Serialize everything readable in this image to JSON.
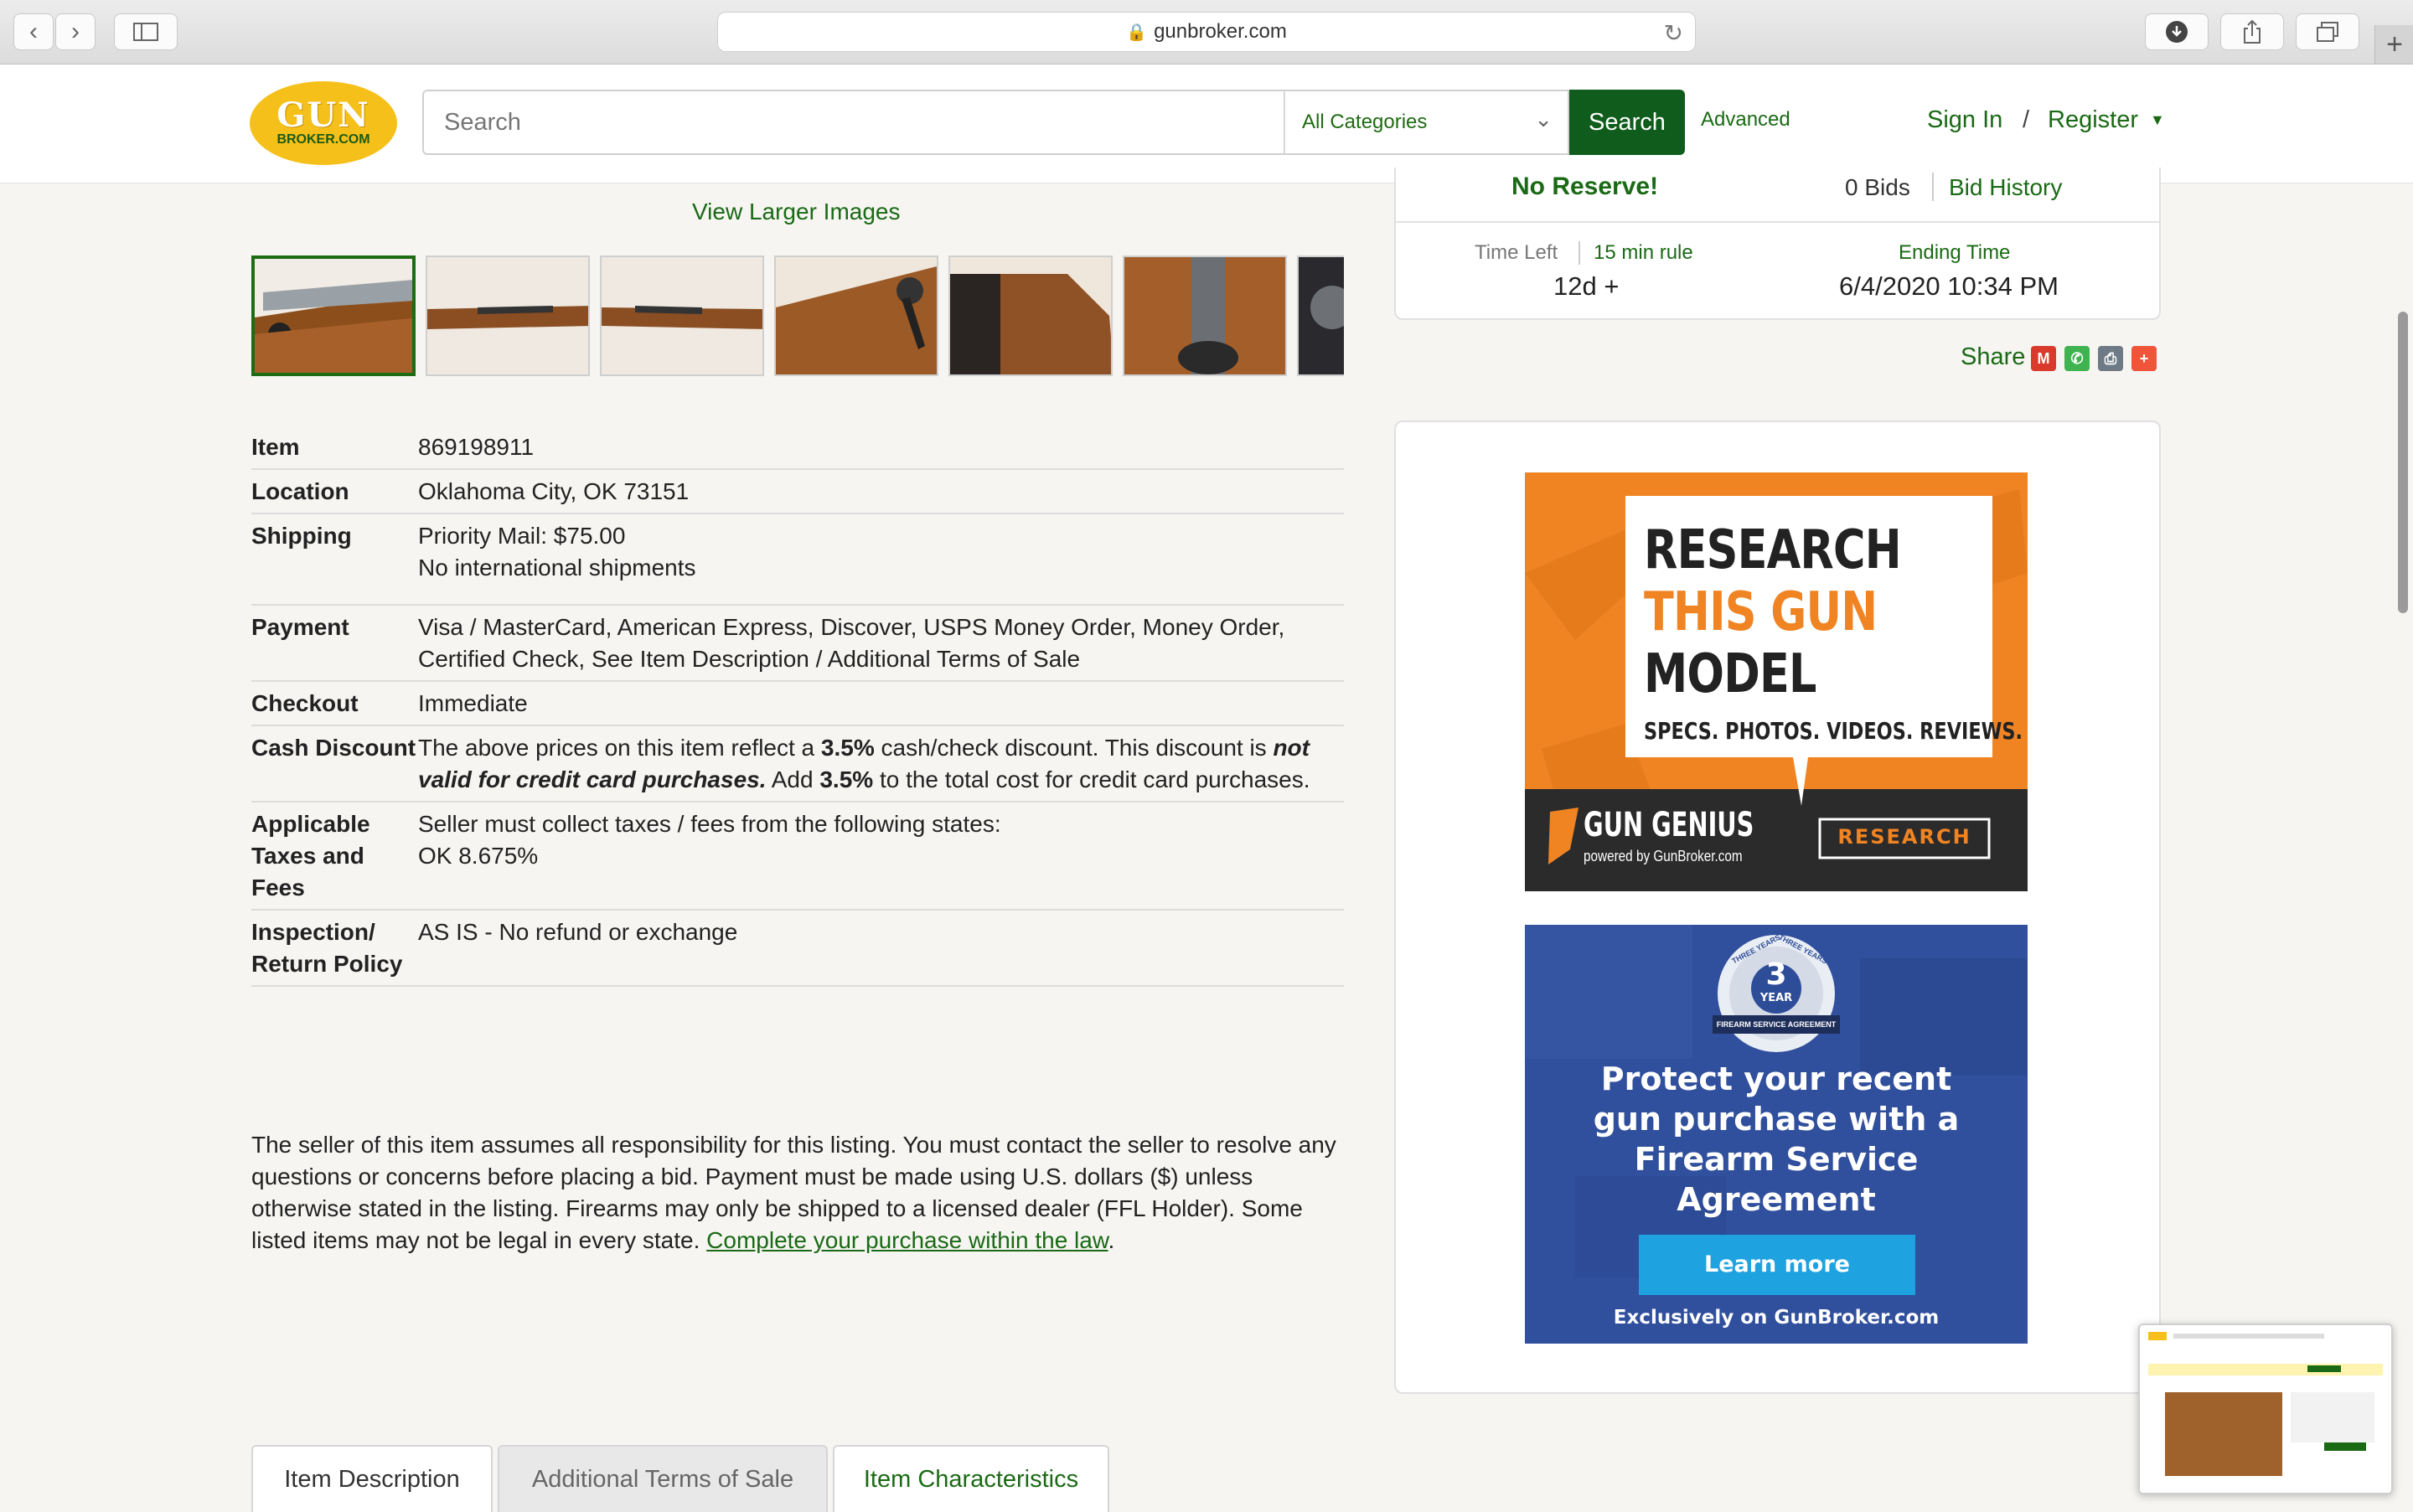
{
  "browser": {
    "url": "gunbroker.com",
    "reload_icon": "reload-icon",
    "lock_icon": "lock-icon"
  },
  "header": {
    "logo_line1": "GUN",
    "logo_line2": "BROKER.COM",
    "search_placeholder": "Search",
    "category": "All Categories",
    "search_button": "Search",
    "advanced": "Advanced",
    "sign_in": "Sign In",
    "separator": "/",
    "register": "Register"
  },
  "bid_panel": {
    "no_reserve": "No Reserve!",
    "bids": "0 Bids",
    "bid_history": "Bid History",
    "time_left_label": "Time Left",
    "rule_link": "15 min rule",
    "time_left": "12d +",
    "ending_label": "Ending Time",
    "ending_time": "6/4/2020 10:34 PM"
  },
  "share": {
    "label": "Share",
    "icons": [
      "gmail-icon",
      "whatsapp-icon",
      "print-icon",
      "more-share-icon"
    ]
  },
  "gallery": {
    "view_larger": "View Larger Images"
  },
  "details": {
    "item_label": "Item",
    "item": "869198911",
    "location_label": "Location",
    "location": "Oklahoma City, OK 73151",
    "shipping_label": "Shipping",
    "shipping_line1": "Priority Mail: $75.00",
    "shipping_line2": "No international shipments",
    "payment_label": "Payment",
    "payment": "Visa / MasterCard, American Express, Discover, USPS Money Order, Money Order, Certified Check, See Item Description / Additional Terms of Sale",
    "checkout_label": "Checkout",
    "checkout": "Immediate",
    "cash_label": "Cash Discount",
    "cash_t1": "The above prices on this item reflect a ",
    "cash_pct1": "3.5%",
    "cash_t2": " cash/check discount. This discount is ",
    "cash_em": "not valid for credit card purchases.",
    "cash_t3": " Add ",
    "cash_pct2": "3.5%",
    "cash_t4": " to the total cost for credit card purchases.",
    "taxes_label": "Applicable Taxes and Fees",
    "taxes_line1": "Seller must collect taxes / fees from the following states:",
    "taxes_line2": "OK 8.675%",
    "inspection_label": "Inspection/ Return Policy",
    "inspection": "AS IS - No refund or exchange"
  },
  "disclaimer": {
    "text": "The seller of this item assumes all responsibility for this listing. You must contact the seller to resolve any questions or concerns before placing a bid. Payment must be made using U.S. dollars ($) unless otherwise stated in the listing. Firearms may only be shipped to a licensed dealer (FFL Holder). Some listed items may not be legal in every state. ",
    "link": "Complete your purchase within the law",
    "end": "."
  },
  "tabs": [
    "Item Description",
    "Additional Terms of Sale",
    "Item Characteristics"
  ],
  "ad_research": {
    "line1": "RESEARCH",
    "line2": "THIS GUN",
    "line3": "MODEL",
    "tagline": "SPECS. PHOTOS. VIDEOS. REVIEWS.",
    "brand": "GUN GENIUS",
    "brand_sub": "powered by GunBroker.com",
    "button": "RESEARCH"
  },
  "ad_protect": {
    "badge_number": "3",
    "badge_word": "YEAR",
    "badge_arc_left": "THREE YEARS",
    "badge_arc_right": "THREE YEARS",
    "badge_ribbon": "FIREARM SERVICE AGREEMENT",
    "headline": "Protect your recent gun purchase with a Firearm Service Agreement",
    "button": "Learn more",
    "footer": "Exclusively on GunBroker.com"
  },
  "colors": {
    "brand_green": "#1a6a15",
    "search_green": "#0f5c1c",
    "logo_yellow": "#f6c01a",
    "ad_orange": "#f08423",
    "ad_blue": "#304f9c"
  }
}
